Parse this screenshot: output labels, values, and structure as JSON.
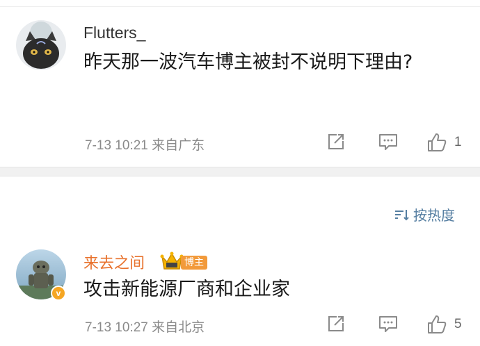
{
  "comments": [
    {
      "username": "Flutters_",
      "text": "昨天那一波汽车博主被封不说明下理由?",
      "meta": "7-13 10:21 来自广东",
      "likes": "1"
    },
    {
      "username": "来去之间",
      "author_badge": "博主",
      "text": "攻击新能源厂商和企业家",
      "meta": "7-13 10:27 来自北京",
      "likes": "5"
    }
  ],
  "sort": {
    "label": "按热度",
    "icon": "sort-icon"
  },
  "icons": {
    "share": "share-icon",
    "comment": "comment-icon",
    "like": "thumbs-up-icon",
    "verified": "verified-v-icon",
    "crown": "crown-icon"
  },
  "colors": {
    "author_name": "#e8722d",
    "sort_link": "#557ea1",
    "meta_gray": "#8a8a8a",
    "badge_orange": "#f29a3b"
  }
}
